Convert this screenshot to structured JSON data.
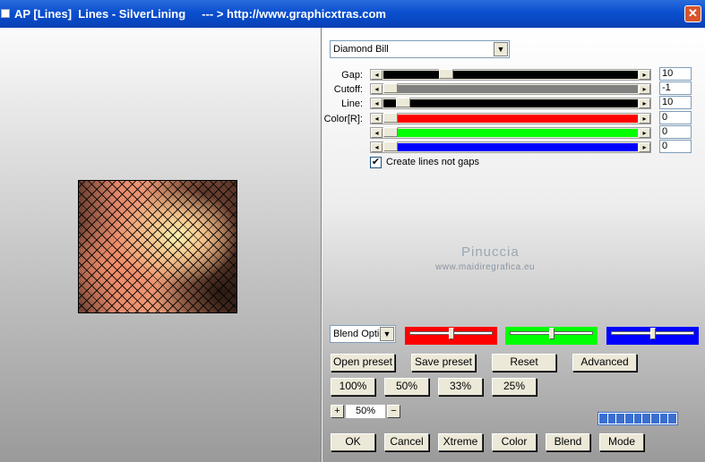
{
  "window": {
    "title": "AP [Lines]  Lines - SilverLining     --- > http://www.graphicxtras.com",
    "close": "✕"
  },
  "preset": {
    "selected": "Diamond Bill"
  },
  "params": [
    {
      "label": "Gap:",
      "value": "10",
      "fraction": 0.23,
      "color": "#000000"
    },
    {
      "label": "Cutoff:",
      "value": "-1",
      "fraction": 0.0,
      "color": "#808080"
    },
    {
      "label": "Line:",
      "value": "10",
      "fraction": 0.05,
      "color": "#000000"
    },
    {
      "label": "Color[R]:",
      "value": "0",
      "fraction": 0.0,
      "color": "#ff0000"
    },
    {
      "label": "",
      "value": "0",
      "fraction": 0.0,
      "color": "#00ff00"
    },
    {
      "label": "",
      "value": "0",
      "fraction": 0.0,
      "color": "#0000ff"
    }
  ],
  "create_lines_not_gaps": {
    "label": "Create lines not gaps",
    "checked": true
  },
  "watermark": {
    "name": "Pinuccia",
    "site": "www.maidiregrafica.eu"
  },
  "blend": {
    "selected": "Blend Optio"
  },
  "color_sliders": [
    {
      "color": "#ff0000",
      "fraction": 0.5
    },
    {
      "color": "#00ff00",
      "fraction": 0.5
    },
    {
      "color": "#0000ff",
      "fraction": 0.5
    }
  ],
  "buttons": {
    "open_preset": "Open preset",
    "save_preset": "Save preset",
    "reset": "Reset",
    "advanced": "Advanced",
    "z100": "100%",
    "z50": "50%",
    "z33": "33%",
    "z25": "25%",
    "ok": "OK",
    "cancel": "Cancel",
    "xtreme": "Xtreme",
    "color": "Color",
    "blend": "Blend",
    "mode": "Mode"
  },
  "zoom": {
    "plus": "+",
    "value": "50%",
    "minus": "−"
  },
  "progress": {
    "segments": 9
  }
}
